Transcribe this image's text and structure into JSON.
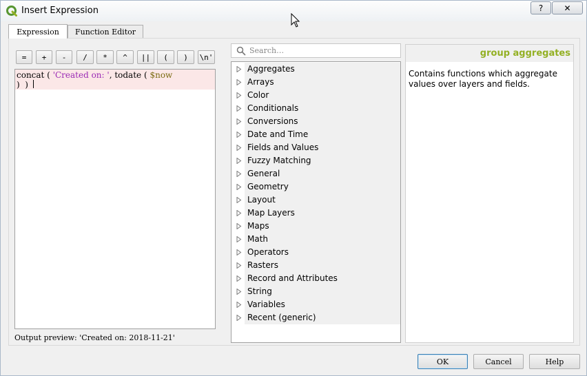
{
  "window": {
    "title": "Insert Expression",
    "help_button": "?",
    "close_button": "✕"
  },
  "tabs": [
    {
      "label": "Expression",
      "active": true
    },
    {
      "label": "Function Editor",
      "active": false
    }
  ],
  "operators": [
    "=",
    "+",
    "-",
    "/",
    "*",
    "^",
    "||",
    "(",
    ")",
    "\\n'"
  ],
  "editor": {
    "code_parts": {
      "p1": "concat ( ",
      "p2": "'Created on: '",
      "p3": ", todate ( ",
      "p4": "$now",
      "p5": "\n)  ) "
    }
  },
  "output_preview": "Output preview:  'Created on: 2018-11-21'",
  "search": {
    "placeholder": "Search…"
  },
  "function_groups": [
    "Aggregates",
    "Arrays",
    "Color",
    "Conditionals",
    "Conversions",
    "Date and Time",
    "Fields and Values",
    "Fuzzy Matching",
    "General",
    "Geometry",
    "Layout",
    "Map Layers",
    "Maps",
    "Math",
    "Operators",
    "Rasters",
    "Record and Attributes",
    "String",
    "Variables",
    "Recent (generic)"
  ],
  "help": {
    "title": "group aggregates",
    "description": "Contains functions which aggregate values over layers and fields."
  },
  "buttons": {
    "ok": "OK",
    "cancel": "Cancel",
    "help": "Help"
  },
  "colors": {
    "help_title": "#93b023",
    "string_literal": "#9b2ab5",
    "variable": "#7a6a10",
    "editor_line_highlight": "#fbe7e7"
  }
}
